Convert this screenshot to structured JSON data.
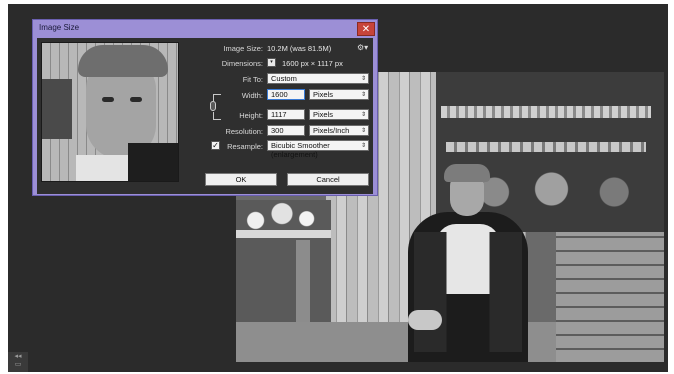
{
  "dialog": {
    "title": "Image Size",
    "close_glyph": "✕",
    "image_size_label": "Image Size:",
    "image_size_value": "10.2M (was 81.5M)",
    "gear_glyph": "⚙▾",
    "dimensions_label": "Dimensions:",
    "dimensions_toggle_glyph": "▾",
    "dimensions_value": "1600 px  ×  1117 px",
    "fit_to_label": "Fit To:",
    "fit_to_value": "Custom",
    "width_label": "Width:",
    "width_value": "1600",
    "width_unit": "Pixels",
    "height_label": "Height:",
    "height_value": "1117",
    "height_unit": "Pixels",
    "resolution_label": "Resolution:",
    "resolution_value": "300",
    "resolution_unit": "Pixels/Inch",
    "resample_label": "Resample:",
    "resample_checked_glyph": "✓",
    "resample_value": "Bicubic Smoother (enlargement)",
    "ok_label": "OK",
    "cancel_label": "Cancel",
    "select_arrow": "⇕"
  },
  "sidebar": {
    "tool_glyphs": [
      "◂◂",
      "▭"
    ]
  },
  "icons": {
    "close": "close-icon",
    "gear": "gear-icon",
    "chain": "chain-link-icon",
    "dropdown": "chevron-updown-icon",
    "checkbox": "checkbox-icon"
  },
  "colors": {
    "dialog_frame": "#9c8fd6",
    "close_button": "#c7443a",
    "dialog_body": "#2f2f2f",
    "workspace": "#2b2b2b"
  }
}
